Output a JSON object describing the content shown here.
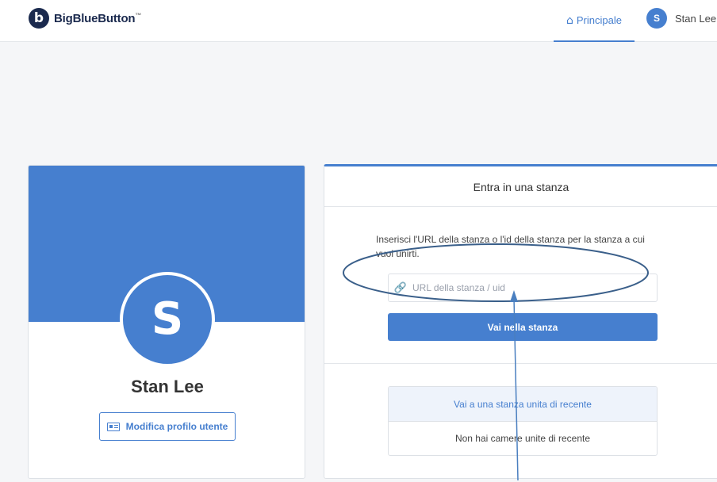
{
  "header": {
    "logo_text": "BigBlueButton",
    "logo_tm": "™",
    "logo_letter": "b",
    "nav_home_label": "Principale",
    "nav_home_icon": "home-icon",
    "user_initial": "S",
    "user_name": "Stan Lee"
  },
  "profile": {
    "avatar_initial": "S",
    "name": "Stan Lee",
    "edit_button_label": "Modifica profilo utente",
    "edit_button_icon": "id-card-icon"
  },
  "join_room": {
    "title": "Entra in una stanza",
    "description": "Inserisci l'URL della stanza o l'id della stanza per la stanza a cui vuoi unirti.",
    "input_placeholder": "URL della stanza / uid",
    "input_value": "",
    "input_icon": "link-icon",
    "go_button_label": "Vai nella stanza",
    "recent_header": "Vai a una stanza unita di recente",
    "recent_empty": "Non hai camere unite di recente"
  },
  "colors": {
    "accent": "#467fcf",
    "annotation": "#3a5f8a",
    "background": "#f5f6f8"
  }
}
